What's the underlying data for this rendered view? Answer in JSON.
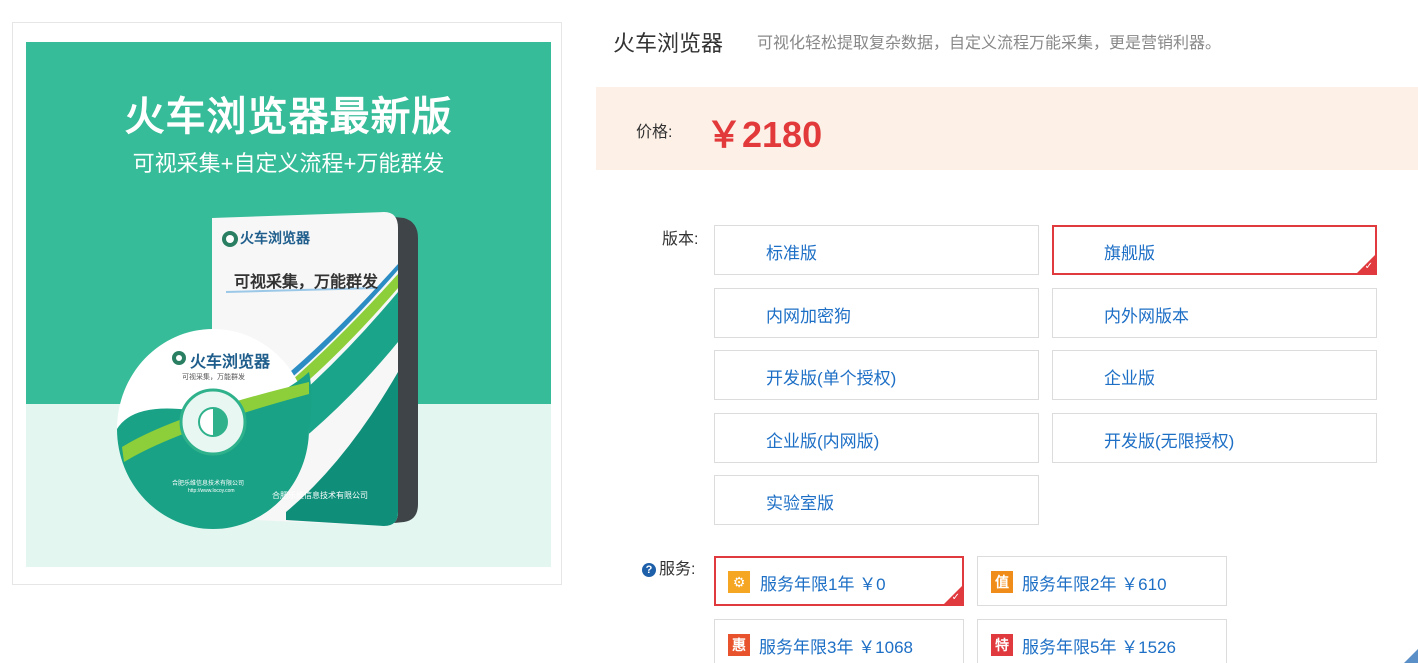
{
  "product": {
    "image": {
      "banner_title": "火车浏览器最新版",
      "banner_subtitle": "可视采集+自定义流程+万能群发",
      "box_brand": "火车浏览器",
      "box_slogan": "可视采集，万能群发",
      "box_company": "合肥乐维信息技术有限公司",
      "disc_brand": "火车浏览器",
      "disc_slogan": "可视采集，万能群发",
      "disc_company": "合肥乐维信息技术有限公司",
      "disc_url": "http://www.locoy.com"
    },
    "title": "火车浏览器",
    "description": "可视化轻松提取复杂数据，自定义流程万能采集，更是营销利器。"
  },
  "price": {
    "label": "价格:",
    "value": "￥2180"
  },
  "version": {
    "label": "版本:",
    "selected": "旗舰版",
    "options": [
      "标准版",
      "旗舰版",
      "内网加密狗",
      "内外网版本",
      "开发版(单个授权)",
      "企业版",
      "企业版(内网版)",
      "开发版(无限授权)",
      "实验室版"
    ]
  },
  "service": {
    "label": "服务:",
    "help_icon": "question-circle-icon",
    "options": [
      {
        "badge": "⚙",
        "badge_color": "#f5a623",
        "text": "服务年限1年 ￥0",
        "selected": true
      },
      {
        "badge": "值",
        "badge_color": "#f08c1a",
        "text": "服务年限2年 ￥610",
        "selected": false
      },
      {
        "badge": "惠",
        "badge_color": "#e8522c",
        "text": "服务年限3年 ￥1068",
        "selected": false
      },
      {
        "badge": "特",
        "badge_color": "#e0393e",
        "text": "服务年限5年 ￥1526",
        "selected": false
      }
    ]
  },
  "colors": {
    "accent_red": "#e0393e",
    "price_red": "#e23a3a",
    "link_blue": "#1d6fc6",
    "banner_green": "#36bc98",
    "price_bg": "#fdf0e7"
  }
}
